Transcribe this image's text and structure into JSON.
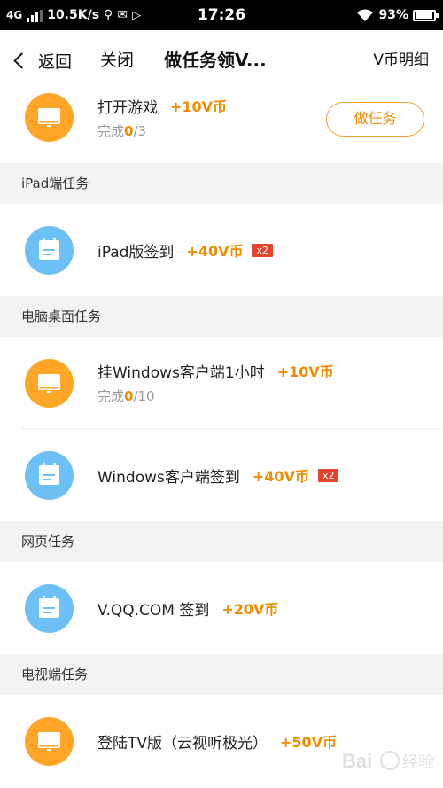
{
  "status_bar": {
    "network": "4G",
    "speed": "10.5K/s",
    "time": "17:26",
    "battery": "93%",
    "battery_level": 0.93
  },
  "nav": {
    "back_label": "返回",
    "close_label": "关闭",
    "title": "做任务领V...",
    "right_label": "V币明细"
  },
  "top_task": {
    "title": "打开游戏",
    "reward": "+10V币",
    "progress_prefix": "完成",
    "progress_done": "0",
    "progress_total": "/3",
    "button_label": "做任务"
  },
  "sections": [
    {
      "header": "iPad端任务",
      "tasks": [
        {
          "title": "iPad版签到",
          "reward": "+40V币",
          "multiplier": "x2"
        }
      ]
    },
    {
      "header": "电脑桌面任务",
      "tasks": [
        {
          "title": "挂Windows客户端1小时",
          "reward": "+10V币",
          "progress_prefix": "完成",
          "progress_done": "0",
          "progress_total": "/10"
        },
        {
          "title": "Windows客户端签到",
          "reward": "+40V币",
          "multiplier": "x2"
        }
      ]
    },
    {
      "header": "网页任务",
      "tasks": [
        {
          "title": "V.QQ.COM 签到",
          "reward": "+20V币"
        }
      ]
    },
    {
      "header": "电视端任务",
      "tasks": [
        {
          "title": "登陆TV版（云视听极光）",
          "reward": "+50V币"
        }
      ]
    }
  ],
  "icons": {
    "orange": "#ffa627",
    "blue": "#6cc0f6",
    "accent": "#f08c00",
    "badge": "#e5432b"
  },
  "watermark": "Bai 经验"
}
